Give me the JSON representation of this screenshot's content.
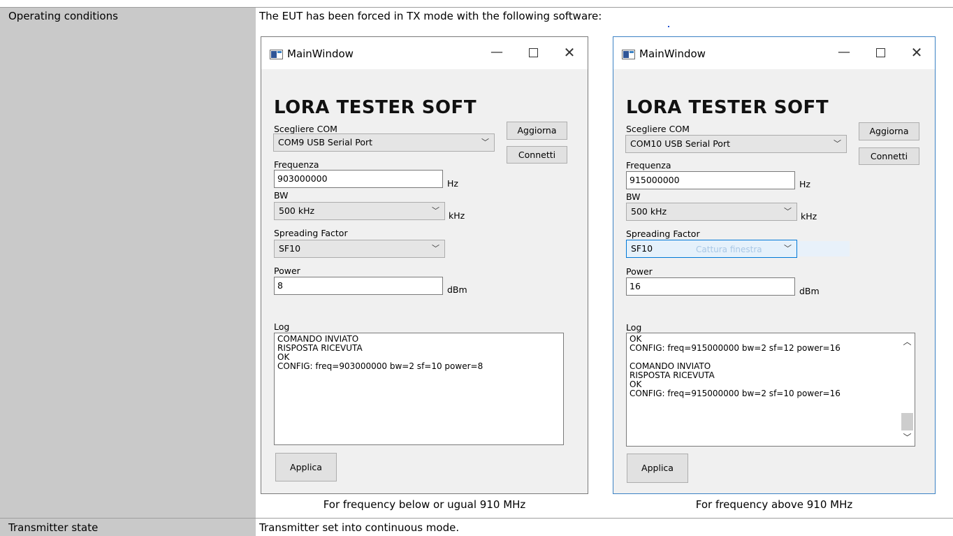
{
  "table": {
    "rows": [
      {
        "label": "Operating conditions",
        "text": "The EUT has been forced in TX mode with the following software:"
      },
      {
        "label": "Transmitter state",
        "text": "Transmitter set into continuous mode."
      }
    ]
  },
  "windows": [
    {
      "title": "MainWindow",
      "app_title": "LORA TESTER SOFT",
      "com_label": "Scegliere COM",
      "com_value": "COM9 USB Serial Port",
      "refresh_button": "Aggiorna",
      "connect_button": "Connetti",
      "freq_label": "Frequenza",
      "freq_value": "903000000",
      "freq_unit": "Hz",
      "bw_label": "BW",
      "bw_value": "500 kHz",
      "bw_unit": "kHz",
      "sf_label": "Spreading Factor",
      "sf_value": "SF10",
      "power_label": "Power",
      "power_value": "8",
      "power_unit": "dBm",
      "log_label": "Log",
      "log_lines": [
        "COMANDO INVIATO",
        "RISPOSTA RICEVUTA",
        "OK",
        "CONFIG: freq=903000000 bw=2 sf=10 power=8"
      ],
      "apply_button": "Applica",
      "caption": "For frequency below or ugual 910 MHz"
    },
    {
      "title": "MainWindow",
      "app_title": "LORA TESTER SOFT",
      "com_label": "Scegliere COM",
      "com_value": "COM10 USB Serial Port",
      "refresh_button": "Aggiorna",
      "connect_button": "Connetti",
      "freq_label": "Frequenza",
      "freq_value": "915000000",
      "freq_unit": "Hz",
      "bw_label": "BW",
      "bw_value": "500 kHz",
      "bw_unit": "kHz",
      "sf_label": "Spreading Factor",
      "sf_value": "SF10",
      "sf_ghost_text": "Cattura finestra",
      "power_label": "Power",
      "power_value": "16",
      "power_unit": "dBm",
      "log_label": "Log",
      "log_lines": [
        "OK",
        "CONFIG: freq=915000000 bw=2 sf=12 power=16",
        "",
        "COMANDO INVIATO",
        "RISPOSTA RICEVUTA",
        "OK",
        "CONFIG: freq=915000000 bw=2 sf=10 power=16"
      ],
      "apply_button": "Applica",
      "caption": "For frequency above 910 MHz"
    }
  ],
  "glyphs": {
    "minimize": "—",
    "close": "✕",
    "chevron": "﹀",
    "scroll_up": "︿",
    "scroll_down": "﹀"
  }
}
